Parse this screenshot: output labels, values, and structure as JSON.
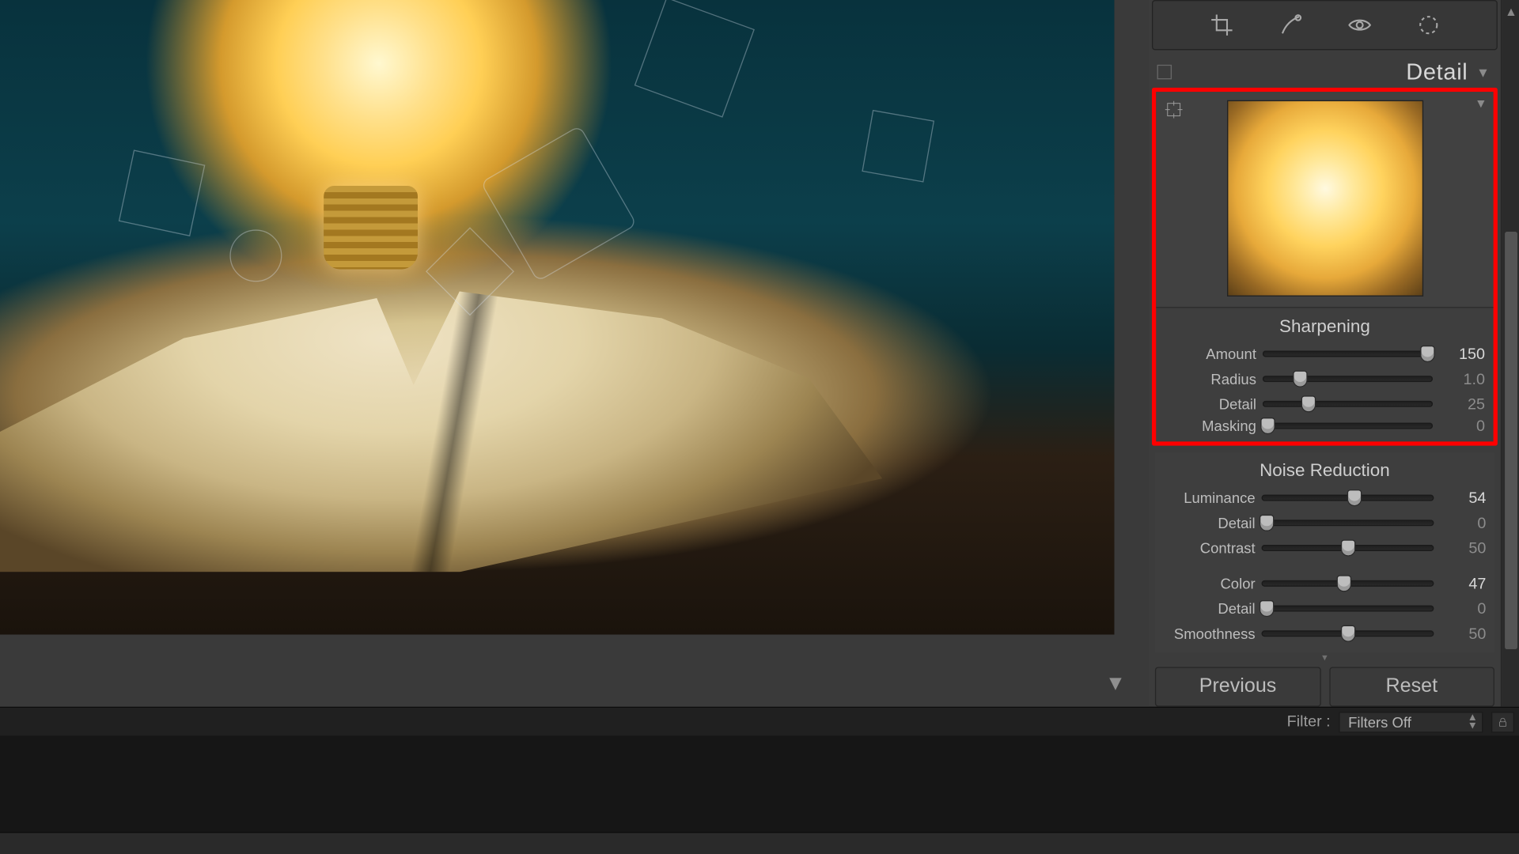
{
  "panel": {
    "title": "Detail",
    "sharpening": {
      "title": "Sharpening",
      "amount": {
        "label": "Amount",
        "value": "150",
        "pos": 97
      },
      "radius": {
        "label": "Radius",
        "value": "1.0",
        "pos": 22
      },
      "detail": {
        "label": "Detail",
        "value": "25",
        "pos": 27
      },
      "masking": {
        "label": "Masking",
        "value": "0",
        "pos": 3
      }
    },
    "noise": {
      "title": "Noise Reduction",
      "luminance": {
        "label": "Luminance",
        "value": "54",
        "pos": 54
      },
      "detail": {
        "label": "Detail",
        "value": "0",
        "pos": 3
      },
      "contrast": {
        "label": "Contrast",
        "value": "50",
        "pos": 50
      },
      "color": {
        "label": "Color",
        "value": "47",
        "pos": 48
      },
      "detail2": {
        "label": "Detail",
        "value": "0",
        "pos": 3
      },
      "smoothness": {
        "label": "Smoothness",
        "value": "50",
        "pos": 50
      }
    },
    "buttons": {
      "previous": "Previous",
      "reset": "Reset"
    }
  },
  "filter": {
    "label": "Filter :",
    "selected": "Filters Off"
  }
}
